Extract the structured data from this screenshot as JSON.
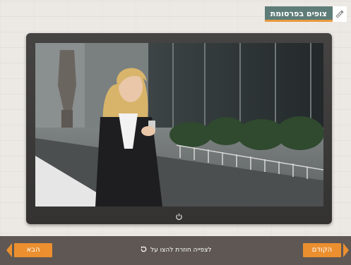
{
  "header": {
    "title": "צופים בפרסומת",
    "icon": "pencil-ruler-icon"
  },
  "video": {
    "scene": "video-frame-businesswoman-with-phone"
  },
  "footer": {
    "prev_label": "הקודם",
    "next_label": "הבא",
    "replay_text": "לצפייה חוזרת להצו על",
    "replay_icon": "replay-icon"
  },
  "colors": {
    "accent": "#eb8f2f",
    "title_bg": "#5f7d78",
    "footer_bg": "#5e5753",
    "monitor": "#3b3a39"
  }
}
